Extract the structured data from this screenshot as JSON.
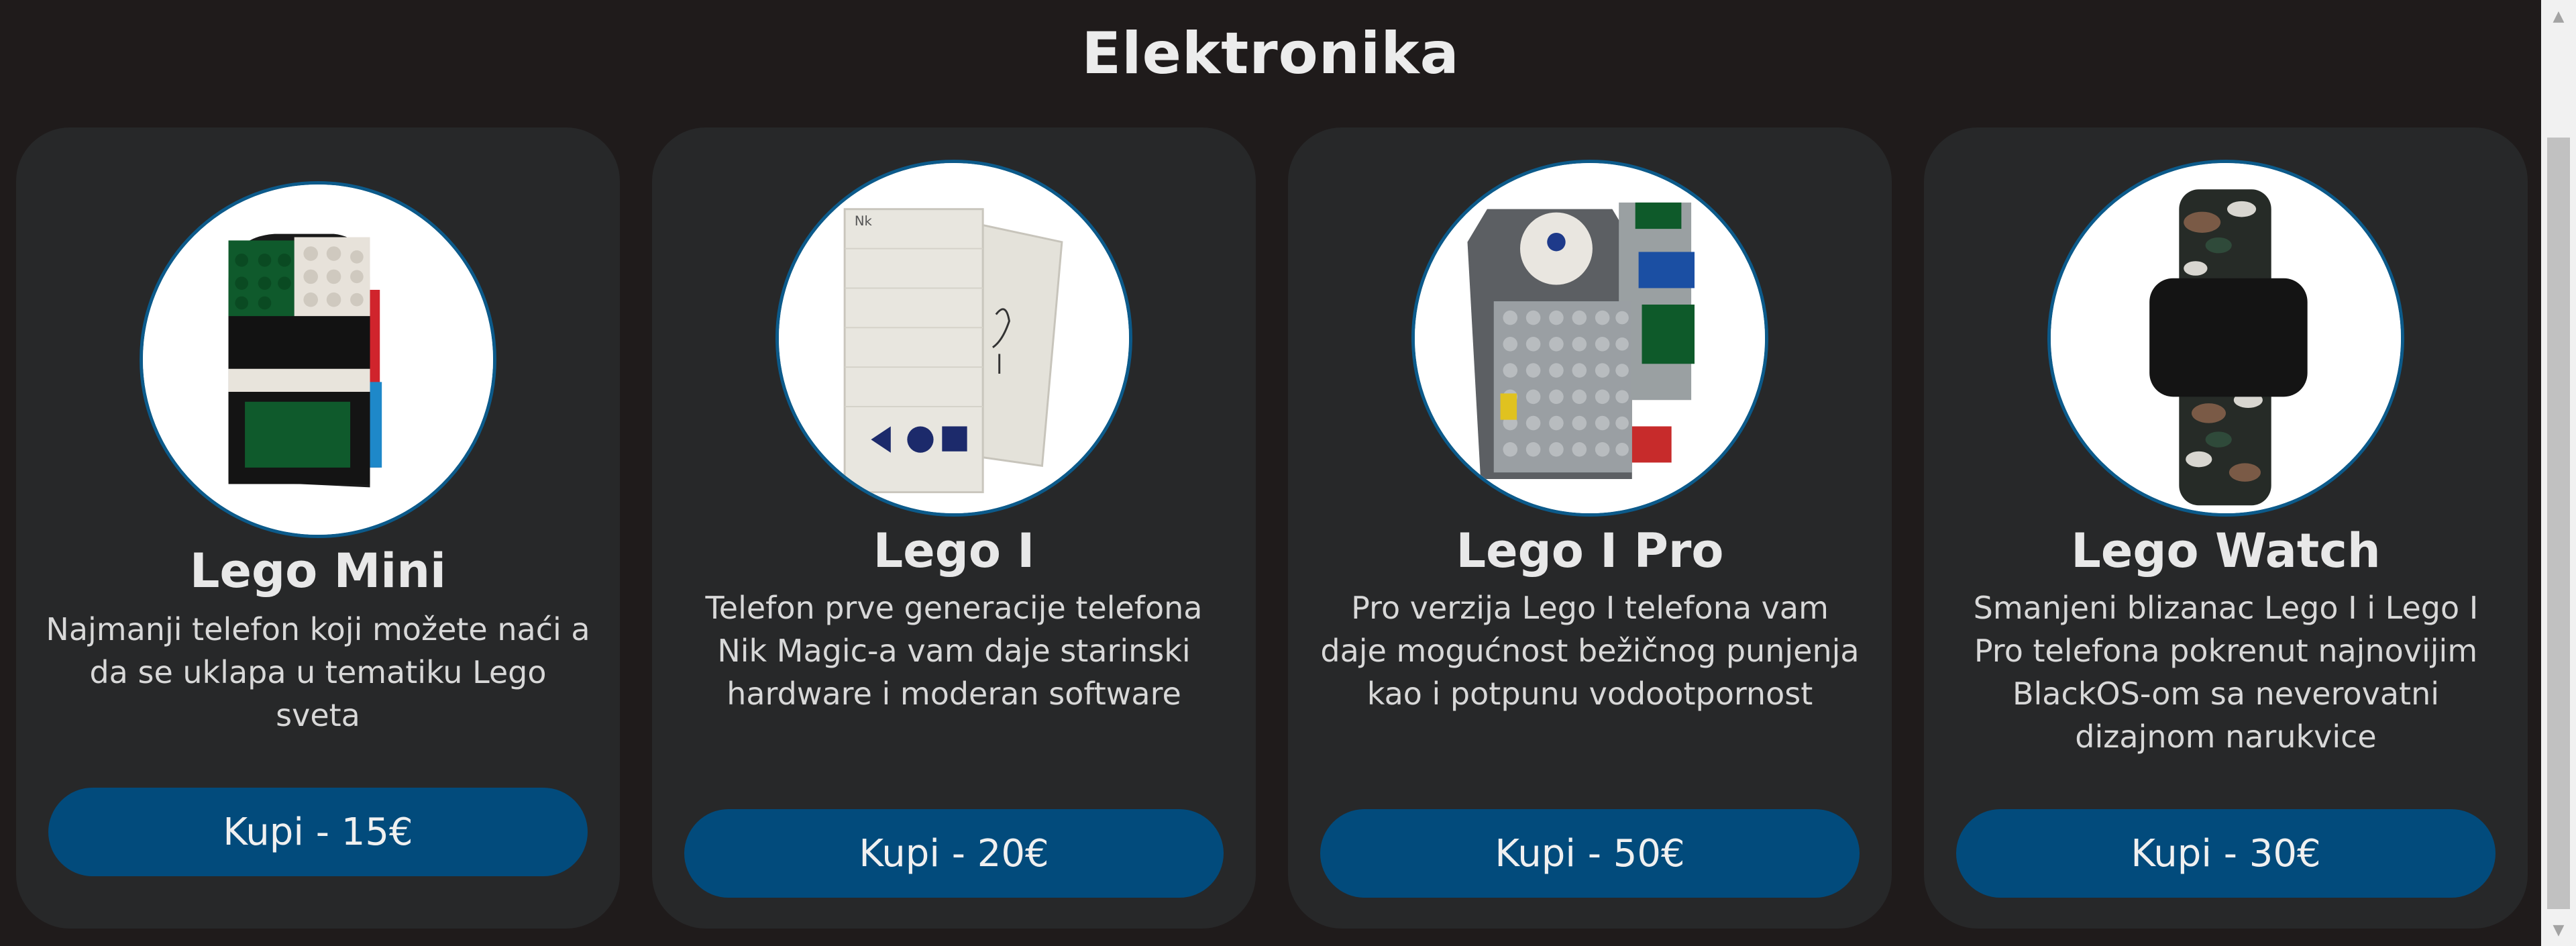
{
  "section": {
    "title": "Elektronika"
  },
  "products": [
    {
      "name": "Lego Mini",
      "description": "Najmanji telefon koji možete naći a da se uklapa u tematiku Lego sveta",
      "buy_label": "Kupi - 15€",
      "image_icon": "lego-phone-green-image"
    },
    {
      "name": "Lego I",
      "description": "Telefon prve generacije telefona Nik Magic-a vam daje starinski hardware i moderan software",
      "buy_label": "Kupi - 20€",
      "image_icon": "lego-phone-white-image"
    },
    {
      "name": "Lego I Pro",
      "description": "Pro verzija Lego I telefona vam daje mogućnost bežičnog punjenja kao i potpunu vodootpornost",
      "buy_label": "Kupi - 50€",
      "image_icon": "lego-phone-grey-image"
    },
    {
      "name": "Lego Watch",
      "description": "Smanjeni blizanac Lego I i Lego I Pro telefona pokrenut najnovijim BlackOS-om sa neverovatni dizajnom narukvice",
      "buy_label": "Kupi - 30€",
      "image_icon": "lego-watch-image"
    }
  ],
  "scrollbar": {
    "up_icon": "scroll-up-arrow-icon",
    "down_icon": "scroll-down-arrow-icon"
  }
}
